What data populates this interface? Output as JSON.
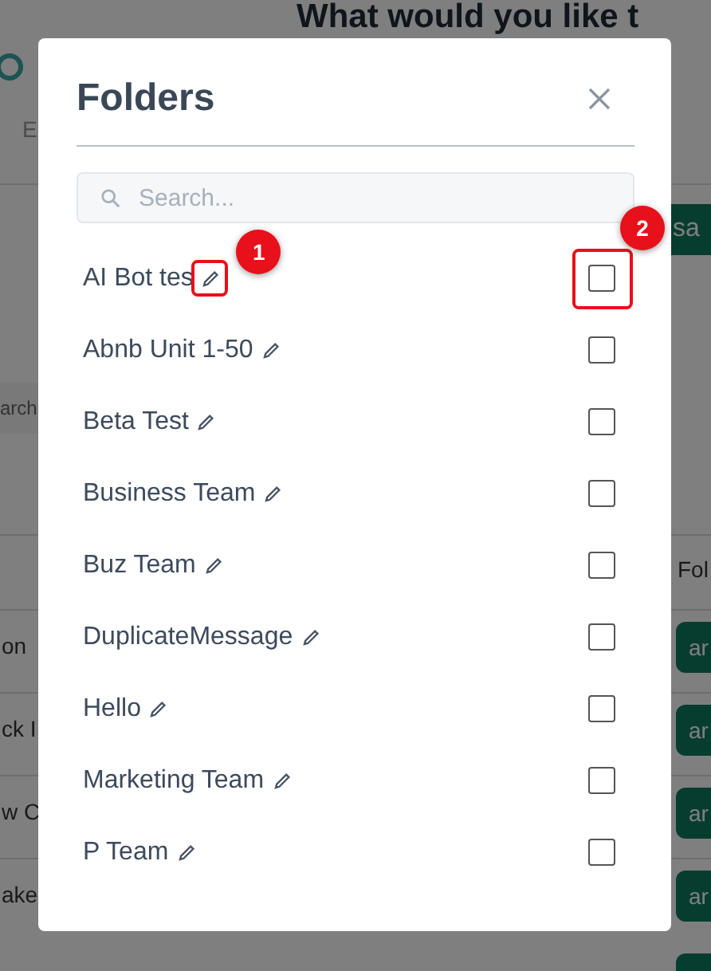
{
  "backdrop": {
    "heading": "What would you like t",
    "tab": "E",
    "action_button": "sa",
    "search_placeholder": "arch",
    "column_header": "Fol",
    "rows": [
      {
        "text": "on",
        "button": "ar"
      },
      {
        "text": "ck I",
        "button": "ar"
      },
      {
        "text": "w C",
        "button": "ar"
      },
      {
        "text": "ake",
        "button": "ar"
      }
    ]
  },
  "dialog": {
    "title": "Folders",
    "search": {
      "placeholder": "Search..."
    },
    "folders": [
      {
        "name": "AI Bot tes",
        "checked": false,
        "annotations": [
          {
            "kind": "edit",
            "label": "1"
          },
          {
            "kind": "checkbox",
            "label": "2"
          }
        ]
      },
      {
        "name": "Abnb Unit 1-50",
        "checked": false
      },
      {
        "name": "Beta Test",
        "checked": false
      },
      {
        "name": "Business Team",
        "checked": false
      },
      {
        "name": "Buz Team",
        "checked": false
      },
      {
        "name": "DuplicateMessage",
        "checked": false
      },
      {
        "name": "Hello",
        "checked": false
      },
      {
        "name": "Marketing Team",
        "checked": false
      },
      {
        "name": "P Team",
        "checked": false
      }
    ]
  }
}
